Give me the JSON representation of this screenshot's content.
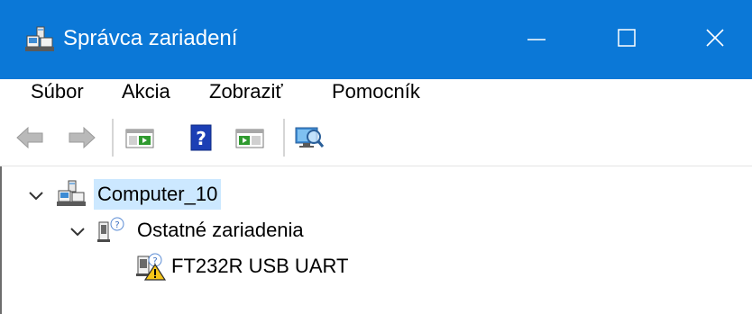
{
  "window": {
    "title": "Správca zariadení",
    "title_icon": "device-manager-icon",
    "accent_color": "#0b78d7",
    "controls": {
      "minimize_icon": "minimize-icon",
      "maximize_icon": "maximize-icon",
      "close_icon": "close-icon"
    }
  },
  "menu": {
    "items": [
      {
        "label": "Súbor"
      },
      {
        "label": "Akcia"
      },
      {
        "label": "Zobraziť"
      },
      {
        "label": "Pomocník"
      }
    ]
  },
  "toolbar": {
    "buttons": [
      {
        "icon": "back-arrow-icon",
        "enabled": false
      },
      {
        "icon": "forward-arrow-icon",
        "enabled": false
      },
      {
        "icon": "show-hide-console-tree-icon",
        "enabled": true
      },
      {
        "icon": "help-icon",
        "enabled": true
      },
      {
        "icon": "properties-icon",
        "enabled": true
      },
      {
        "icon": "scan-hardware-changes-icon",
        "enabled": true
      }
    ]
  },
  "tree": {
    "root": {
      "label": "Computer_10",
      "icon": "computer-icon",
      "expanded": true,
      "selected": true
    },
    "category": {
      "label": "Ostatné zariadenia",
      "icon": "unknown-device-icon",
      "expanded": true
    },
    "device": {
      "label": "FT232R USB UART",
      "icon": "device-warning-icon",
      "status": "warning"
    },
    "selection_color": "#cce8ff"
  }
}
